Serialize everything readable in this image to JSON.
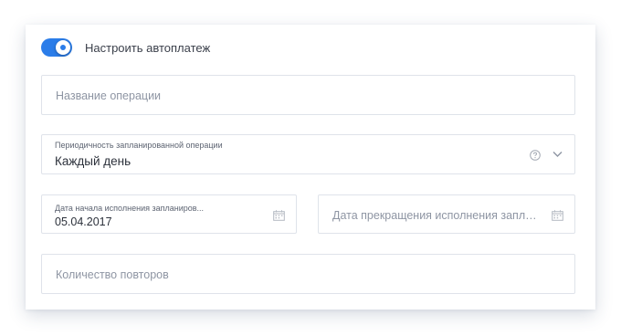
{
  "autopay": {
    "label": "Настроить автоплатеж",
    "enabled": true
  },
  "fields": {
    "operation_name": {
      "placeholder": "Название операции"
    },
    "periodicity": {
      "label": "Периодичность запланированной операции",
      "value": "Каждый день"
    },
    "start_date": {
      "label": "Дата начала исполнения запланиров...",
      "value": "05.04.2017"
    },
    "end_date": {
      "placeholder": "Дата прекращения исполнения заплан..."
    },
    "repeat_count": {
      "placeholder": "Количество повторов"
    }
  },
  "icons": {
    "help": "help-circle-icon",
    "dropdown": "chevron-down-icon",
    "calendar": "calendar-icon"
  },
  "colors": {
    "accent": "#2b7de9",
    "border": "#dfe3ea",
    "placeholder": "#8e95a3"
  }
}
